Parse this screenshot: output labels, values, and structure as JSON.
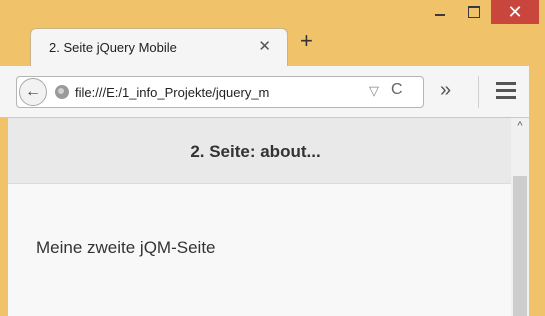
{
  "window": {
    "minimize_label": "",
    "maximize_label": "",
    "close_label": "✕"
  },
  "tab": {
    "title": "2. Seite jQuery Mobile",
    "close_label": "✕",
    "new_tab_label": "+"
  },
  "navbar": {
    "back_label": "←",
    "url": "file:///E:/1_info_Projekte/jquery_m",
    "dropdown_label": "▽",
    "reload_label": "C",
    "overflow_label": "»"
  },
  "page": {
    "header_title": "2. Seite: about...",
    "body_text": "Meine zweite jQM-Seite"
  },
  "icons": {
    "back": "back-arrow-icon",
    "globe": "globe-icon",
    "reload": "reload-icon",
    "menu": "hamburger-menu-icon"
  },
  "colors": {
    "frame": "#f0c36a",
    "close_button": "#c9463d",
    "header_bg": "#e9e9e9"
  }
}
